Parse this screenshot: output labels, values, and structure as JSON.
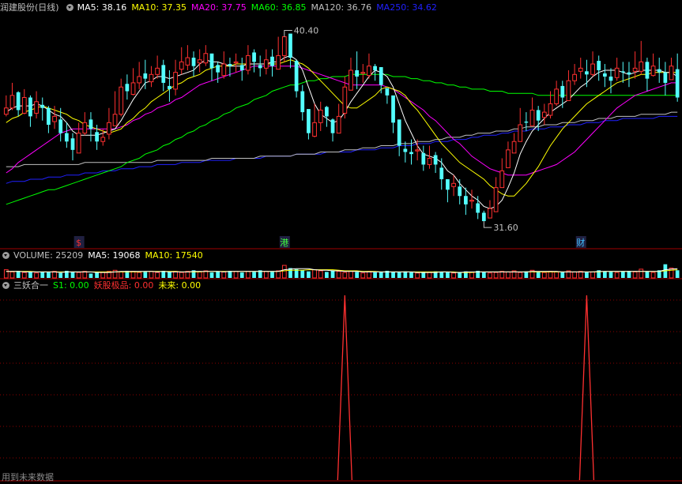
{
  "main_legend": {
    "stock": "润建股份(日线)",
    "ma5": "MA5: 38.16",
    "ma10": "MA10: 37.35",
    "ma20": "MA20: 37.75",
    "ma60": "MA60: 36.85",
    "ma120": "MA120: 36.76",
    "ma250": "MA250: 34.62"
  },
  "annotations": {
    "high": "40.40",
    "low": "31.60"
  },
  "event_marks": [
    {
      "label": "$",
      "color": "#ff3030"
    },
    {
      "label": "港",
      "color": "#40ff40"
    },
    {
      "label": "财",
      "color": "#40c0ff"
    }
  ],
  "volume_legend": {
    "label": "VOLUME: 25209",
    "ma5": "MA5: 19068",
    "ma10": "MA10: 17540"
  },
  "indicator_legend": {
    "name": "三妖合一",
    "s1": "S1: 0.00",
    "yaoguji": "妖股极品: 0.00",
    "weilai": "未来: 0.00"
  },
  "footer": "用到未来数据",
  "colors": {
    "up": "#ff3030",
    "down": "#54ffff",
    "ma5": "#ffffff",
    "ma10": "#ffff00",
    "ma20": "#ff00ff",
    "ma60": "#00ff00",
    "ma120": "#c0c0c0",
    "ma250": "#2020ff",
    "grid": "#8b0000",
    "volume_ma5": "#ffffff",
    "volume_ma10": "#ffff00"
  },
  "chart_data": [
    {
      "type": "candlestick",
      "close": [
        37.0,
        37.6,
        36.9,
        37.5,
        36.6,
        37.3,
        37.0,
        36.2,
        36.6,
        35.8,
        35.4,
        35.0,
        35.8,
        36.3,
        36.0,
        35.4,
        35.6,
        36.3,
        36.7,
        38.0,
        37.8,
        38.2,
        38.5,
        38.4,
        38.6,
        38.9,
        38.2,
        37.9,
        38.7,
        39.2,
        39.4,
        39.0,
        39.3,
        39.6,
        38.9,
        38.7,
        39.1,
        39.0,
        39.2,
        38.8,
        39.5,
        39.2,
        38.9,
        39.3,
        39.0,
        39.5,
        40.4,
        39.4,
        37.8,
        36.8,
        35.8,
        36.3,
        36.9,
        36.6,
        35.8,
        36.6,
        38.0,
        38.8,
        38.5,
        38.7,
        39.0,
        38.8,
        38.1,
        37.6,
        36.3,
        35.2,
        34.9,
        34.8,
        35.0,
        34.3,
        34.6,
        34.3,
        33.6,
        33.1,
        33.4,
        32.8,
        32.4,
        32.6,
        32.0,
        31.6,
        32.2,
        33.2,
        34.0,
        35.0,
        35.4,
        36.2,
        36.3,
        36.9,
        36.4,
        36.8,
        37.2,
        37.9,
        37.5,
        38.3,
        38.6,
        38.9,
        38.6,
        39.1,
        38.8,
        38.5,
        38.3,
        38.9,
        38.7,
        38.6,
        38.9,
        39.2,
        38.4,
        39.0,
        38.7,
        38.2,
        39.0,
        37.5
      ],
      "high": [
        37.6,
        38.2,
        37.8,
        37.9,
        37.6,
        37.8,
        37.5,
        37.1,
        37.1,
        37.0,
        36.3,
        35.8,
        36.3,
        36.8,
        36.8,
        36.2,
        36.0,
        37.0,
        37.8,
        38.4,
        38.6,
        38.9,
        39.2,
        39.3,
        39.0,
        39.5,
        39.3,
        38.8,
        39.3,
        39.9,
        40.0,
        39.7,
        39.8,
        40.0,
        39.5,
        39.2,
        39.7,
        39.4,
        39.6,
        39.4,
        40.0,
        39.8,
        39.5,
        39.8,
        39.8,
        40.4,
        40.4,
        40.0,
        39.3,
        38.1,
        36.5,
        37.2,
        37.3,
        37.1,
        36.5,
        37.2,
        38.5,
        39.4,
        39.7,
        39.1,
        39.6,
        39.1,
        38.9,
        37.9,
        37.3,
        36.1,
        35.4,
        35.5,
        35.5,
        35.2,
        35.2,
        34.9,
        34.6,
        33.6,
        33.8,
        33.6,
        33.2,
        33.1,
        32.8,
        32.1,
        32.6,
        33.7,
        34.6,
        35.4,
        35.8,
        37.0,
        36.8,
        37.5,
        37.1,
        37.2,
        37.8,
        38.3,
        38.3,
        38.8,
        39.1,
        39.4,
        39.3,
        39.7,
        39.5,
        39.1,
        38.9,
        39.4,
        39.2,
        39.2,
        39.7,
        40.2,
        39.4,
        39.6,
        39.4,
        39.2,
        39.4,
        39.6
      ],
      "low": [
        36.6,
        36.9,
        36.6,
        36.7,
        36.1,
        36.5,
        36.4,
        35.8,
        36.0,
        35.4,
        35.1,
        34.5,
        35.0,
        35.7,
        35.4,
        35.0,
        35.2,
        35.5,
        36.2,
        36.6,
        37.4,
        37.6,
        37.9,
        37.9,
        38.0,
        38.4,
        37.8,
        37.3,
        37.6,
        38.6,
        38.8,
        38.5,
        38.7,
        39.0,
        38.3,
        38.2,
        38.4,
        38.5,
        38.7,
        38.3,
        38.6,
        38.7,
        38.5,
        38.6,
        38.5,
        38.9,
        39.2,
        38.9,
        37.5,
        36.4,
        35.5,
        35.6,
        35.9,
        36.1,
        35.4,
        35.9,
        36.5,
        38.0,
        37.9,
        38.2,
        38.4,
        38.3,
        37.7,
        37.2,
        35.8,
        34.7,
        34.4,
        34.3,
        34.5,
        34.0,
        34.1,
        33.9,
        33.1,
        32.5,
        32.8,
        32.4,
        31.9,
        32.2,
        31.7,
        31.6,
        31.8,
        32.3,
        33.2,
        34.3,
        34.9,
        35.5,
        35.9,
        36.4,
        35.9,
        36.2,
        36.5,
        37.1,
        37.0,
        37.7,
        38.1,
        38.4,
        38.0,
        38.5,
        38.3,
        38.0,
        37.7,
        38.3,
        38.2,
        38.0,
        38.4,
        38.6,
        37.8,
        38.5,
        38.2,
        37.6,
        38.5,
        37.3
      ],
      "ma5": [
        36.8,
        37.0,
        37.1,
        37.1,
        37.1,
        37.2,
        37.1,
        36.9,
        36.7,
        36.6,
        36.3,
        35.9,
        35.7,
        35.7,
        35.7,
        35.7,
        35.8,
        35.9,
        36.0,
        36.4,
        36.9,
        37.4,
        37.8,
        38.2,
        38.3,
        38.5,
        38.5,
        38.4,
        38.5,
        38.6,
        38.7,
        38.8,
        39.1,
        39.3,
        39.2,
        39.2,
        39.1,
        39.0,
        39.0,
        39.0,
        39.1,
        39.1,
        39.1,
        39.1,
        39.2,
        39.2,
        39.4,
        39.5,
        39.3,
        38.8,
        38.0,
        37.2,
        36.7,
        36.5,
        36.3,
        36.4,
        36.8,
        37.3,
        37.7,
        38.1,
        38.5,
        38.8,
        38.7,
        38.5,
        38.0,
        37.2,
        36.4,
        35.8,
        35.2,
        34.8,
        34.7,
        34.6,
        34.4,
        34.0,
        33.8,
        33.4,
        33.1,
        32.8,
        32.6,
        32.3,
        32.2,
        32.3,
        32.6,
        33.2,
        33.9,
        34.8,
        35.4,
        35.9,
        36.2,
        36.5,
        36.8,
        37.0,
        37.2,
        37.4,
        37.7,
        38.0,
        38.2,
        38.5,
        38.7,
        38.8,
        38.8,
        38.8,
        38.7,
        38.6,
        38.7,
        38.8,
        38.8,
        38.8,
        38.8,
        38.7,
        38.7,
        38.5
      ],
      "ma10": [
        36.3,
        36.5,
        36.6,
        36.8,
        36.9,
        37.0,
        37.1,
        37.0,
        36.9,
        36.8,
        36.7,
        36.5,
        36.4,
        36.2,
        36.1,
        36.0,
        35.9,
        35.8,
        35.9,
        36.0,
        36.3,
        36.5,
        36.8,
        37.0,
        37.3,
        37.5,
        37.7,
        37.9,
        38.1,
        38.2,
        38.4,
        38.5,
        38.6,
        38.8,
        38.9,
        39.0,
        39.0,
        39.0,
        39.1,
        39.1,
        39.1,
        39.1,
        39.1,
        39.1,
        39.1,
        39.1,
        39.2,
        39.3,
        39.2,
        39.1,
        38.9,
        38.6,
        38.3,
        38.0,
        37.7,
        37.4,
        37.1,
        37.0,
        37.0,
        37.2,
        37.4,
        37.6,
        37.9,
        38.0,
        37.9,
        37.8,
        37.6,
        37.2,
        36.9,
        36.5,
        36.1,
        35.7,
        35.3,
        35.0,
        34.7,
        34.4,
        34.2,
        34.0,
        33.8,
        33.6,
        33.3,
        33.1,
        32.9,
        32.8,
        32.8,
        33.1,
        33.4,
        33.8,
        34.2,
        34.7,
        35.2,
        35.6,
        36.0,
        36.3,
        36.6,
        36.9,
        37.2,
        37.4,
        37.6,
        37.8,
        38.0,
        38.2,
        38.3,
        38.4,
        38.5,
        38.6,
        38.6,
        38.7,
        38.7,
        38.7,
        38.7,
        38.7
      ],
      "ma20": [
        33.9,
        34.1,
        34.4,
        34.6,
        34.8,
        35.0,
        35.2,
        35.4,
        35.6,
        35.8,
        35.9,
        36.0,
        36.0,
        36.0,
        36.0,
        36.0,
        36.0,
        36.0,
        36.0,
        36.1,
        36.2,
        36.4,
        36.5,
        36.7,
        36.8,
        37.0,
        37.1,
        37.2,
        37.4,
        37.5,
        37.7,
        37.9,
        38.1,
        38.2,
        38.3,
        38.4,
        38.5,
        38.6,
        38.7,
        38.8,
        38.9,
        39.0,
        39.0,
        39.0,
        39.0,
        39.0,
        39.0,
        39.0,
        39.0,
        38.9,
        38.8,
        38.7,
        38.6,
        38.5,
        38.4,
        38.3,
        38.2,
        38.1,
        38.1,
        38.1,
        38.1,
        38.1,
        38.1,
        38.0,
        37.9,
        37.7,
        37.5,
        37.3,
        37.1,
        36.9,
        36.6,
        36.4,
        36.1,
        35.8,
        35.5,
        35.3,
        35.0,
        34.7,
        34.5,
        34.3,
        34.1,
        34.0,
        33.9,
        33.8,
        33.8,
        33.8,
        33.8,
        33.9,
        34.0,
        34.1,
        34.2,
        34.3,
        34.5,
        34.7,
        34.9,
        35.2,
        35.5,
        35.8,
        36.1,
        36.4,
        36.7,
        37.0,
        37.2,
        37.4,
        37.6,
        37.7,
        37.8,
        37.9,
        38.0,
        38.1,
        38.2,
        38.2
      ],
      "ma60": [
        32.4,
        32.5,
        32.6,
        32.7,
        32.8,
        32.9,
        33.0,
        33.1,
        33.1,
        33.2,
        33.3,
        33.4,
        33.5,
        33.6,
        33.7,
        33.8,
        33.9,
        34.0,
        34.1,
        34.2,
        34.4,
        34.5,
        34.6,
        34.8,
        34.9,
        35.0,
        35.2,
        35.3,
        35.5,
        35.6,
        35.8,
        35.9,
        36.1,
        36.2,
        36.4,
        36.5,
        36.7,
        36.8,
        37.0,
        37.1,
        37.2,
        37.4,
        37.5,
        37.6,
        37.8,
        37.9,
        38.0,
        38.1,
        38.1,
        38.2,
        38.3,
        38.3,
        38.4,
        38.4,
        38.5,
        38.5,
        38.5,
        38.6,
        38.6,
        38.6,
        38.6,
        38.6,
        38.6,
        38.6,
        38.5,
        38.5,
        38.5,
        38.4,
        38.4,
        38.3,
        38.3,
        38.2,
        38.2,
        38.1,
        38.1,
        38.0,
        38.0,
        37.9,
        37.9,
        37.9,
        37.8,
        37.8,
        37.8,
        37.7,
        37.7,
        37.7,
        37.7,
        37.7,
        37.6,
        37.6,
        37.6,
        37.6,
        37.6,
        37.6,
        37.6,
        37.6,
        37.6,
        37.6,
        37.6,
        37.6,
        37.6,
        37.6,
        37.6,
        37.6,
        37.6,
        37.6,
        37.6,
        37.6,
        37.6,
        37.6,
        37.6,
        37.6
      ],
      "ma120": [
        34.2,
        34.2,
        34.2,
        34.3,
        34.3,
        34.3,
        34.3,
        34.3,
        34.3,
        34.3,
        34.3,
        34.3,
        34.3,
        34.4,
        34.4,
        34.4,
        34.4,
        34.4,
        34.4,
        34.4,
        34.4,
        34.4,
        34.4,
        34.4,
        34.4,
        34.5,
        34.5,
        34.5,
        34.5,
        34.5,
        34.5,
        34.5,
        34.5,
        34.5,
        34.6,
        34.6,
        34.6,
        34.6,
        34.6,
        34.6,
        34.6,
        34.6,
        34.7,
        34.7,
        34.7,
        34.7,
        34.7,
        34.7,
        34.8,
        34.8,
        34.8,
        34.8,
        34.9,
        34.9,
        34.9,
        34.9,
        35.0,
        35.0,
        35.0,
        35.1,
        35.1,
        35.1,
        35.2,
        35.2,
        35.2,
        35.3,
        35.3,
        35.3,
        35.4,
        35.4,
        35.4,
        35.5,
        35.5,
        35.6,
        35.6,
        35.6,
        35.7,
        35.7,
        35.8,
        35.8,
        35.8,
        35.9,
        35.9,
        35.9,
        36.0,
        36.0,
        36.1,
        36.1,
        36.1,
        36.2,
        36.2,
        36.2,
        36.3,
        36.3,
        36.3,
        36.4,
        36.4,
        36.4,
        36.5,
        36.5,
        36.5,
        36.6,
        36.6,
        36.6,
        36.6,
        36.7,
        36.7,
        36.7,
        36.7,
        36.7,
        36.8,
        36.8
      ],
      "ma250": [
        33.4,
        33.5,
        33.5,
        33.5,
        33.6,
        33.6,
        33.6,
        33.7,
        33.7,
        33.7,
        33.8,
        33.8,
        33.8,
        33.9,
        33.9,
        33.9,
        34.0,
        34.0,
        34.0,
        34.1,
        34.1,
        34.1,
        34.2,
        34.2,
        34.2,
        34.3,
        34.3,
        34.3,
        34.3,
        34.4,
        34.4,
        34.4,
        34.4,
        34.5,
        34.5,
        34.5,
        34.5,
        34.5,
        34.6,
        34.6,
        34.6,
        34.6,
        34.6,
        34.7,
        34.7,
        34.7,
        34.7,
        34.7,
        34.8,
        34.8,
        34.8,
        34.8,
        34.8,
        34.9,
        34.9,
        34.9,
        34.9,
        34.9,
        35.0,
        35.0,
        35.0,
        35.0,
        35.1,
        35.1,
        35.1,
        35.2,
        35.2,
        35.2,
        35.3,
        35.3,
        35.3,
        35.4,
        35.4,
        35.4,
        35.5,
        35.5,
        35.5,
        35.6,
        35.6,
        35.7,
        35.7,
        35.7,
        35.8,
        35.8,
        35.9,
        35.9,
        35.9,
        36.0,
        36.0,
        36.0,
        36.1,
        36.1,
        36.1,
        36.2,
        36.2,
        36.2,
        36.3,
        36.3,
        36.3,
        36.4,
        36.4,
        36.4,
        36.5,
        36.5,
        36.5,
        36.5,
        36.5,
        36.5,
        36.6,
        36.6,
        36.6,
        36.6
      ],
      "ylim": [
        31.0,
        41.4
      ],
      "high_label_index": 46,
      "low_label_index": 79,
      "event_indices": [
        12,
        46,
        95
      ]
    },
    {
      "type": "bar",
      "volume": [
        15,
        11,
        13,
        10,
        12,
        9,
        11,
        10,
        12,
        9,
        13,
        11,
        10,
        12,
        8,
        11,
        10,
        12,
        14,
        11,
        13,
        12,
        10,
        11,
        12,
        10,
        13,
        11,
        12,
        10,
        12,
        14,
        11,
        13,
        10,
        12,
        11,
        13,
        12,
        10,
        12,
        11,
        14,
        12,
        11,
        13,
        23,
        18,
        16,
        14,
        12,
        15,
        13,
        11,
        14,
        12,
        10,
        13,
        11,
        9,
        12,
        10,
        11,
        13,
        11,
        10,
        12,
        10,
        9,
        11,
        10,
        12,
        11,
        10,
        9,
        11,
        12,
        10,
        13,
        11,
        9,
        10,
        12,
        11,
        13,
        10,
        12,
        14,
        11,
        10,
        12,
        11,
        10,
        13,
        11,
        12,
        10,
        11,
        14,
        12,
        11,
        10,
        12,
        13,
        11,
        16,
        12,
        10,
        14,
        25,
        18,
        14
      ],
      "ma5": [
        12,
        12,
        12,
        11,
        11,
        11,
        11,
        11,
        11,
        10,
        11,
        11,
        11,
        11,
        11,
        10,
        10,
        10,
        11,
        12,
        12,
        12,
        12,
        12,
        12,
        11,
        12,
        11,
        11,
        11,
        11,
        12,
        12,
        12,
        12,
        12,
        11,
        12,
        12,
        12,
        12,
        12,
        12,
        12,
        12,
        12,
        15,
        16,
        17,
        17,
        17,
        15,
        14,
        14,
        13,
        13,
        12,
        12,
        12,
        11,
        11,
        11,
        11,
        11,
        11,
        11,
        11,
        11,
        10,
        10,
        10,
        10,
        11,
        11,
        10,
        10,
        11,
        11,
        11,
        11,
        11,
        11,
        11,
        11,
        11,
        11,
        11,
        12,
        12,
        12,
        12,
        12,
        11,
        11,
        11,
        11,
        11,
        11,
        12,
        12,
        12,
        12,
        12,
        12,
        12,
        12,
        12,
        12,
        12,
        15,
        16,
        17
      ],
      "ma10": [
        12,
        12,
        12,
        12,
        12,
        11,
        11,
        11,
        11,
        11,
        11,
        11,
        11,
        11,
        11,
        11,
        11,
        11,
        11,
        11,
        11,
        11,
        11,
        12,
        12,
        12,
        12,
        12,
        12,
        11,
        11,
        11,
        11,
        12,
        12,
        12,
        12,
        12,
        12,
        12,
        12,
        12,
        12,
        12,
        12,
        12,
        13,
        14,
        14,
        14,
        15,
        15,
        15,
        15,
        15,
        14,
        13,
        13,
        13,
        12,
        12,
        12,
        11,
        11,
        11,
        11,
        11,
        11,
        11,
        11,
        11,
        11,
        11,
        11,
        11,
        10,
        10,
        10,
        11,
        11,
        11,
        11,
        11,
        11,
        11,
        11,
        11,
        11,
        11,
        11,
        11,
        11,
        11,
        11,
        11,
        11,
        11,
        11,
        11,
        12,
        12,
        12,
        12,
        12,
        12,
        12,
        12,
        12,
        12,
        13,
        14,
        15
      ],
      "ylim": [
        0,
        26
      ]
    },
    {
      "type": "line",
      "name": "三妖合一",
      "spikes": [
        56,
        96
      ],
      "ylim": [
        0,
        1
      ]
    }
  ]
}
